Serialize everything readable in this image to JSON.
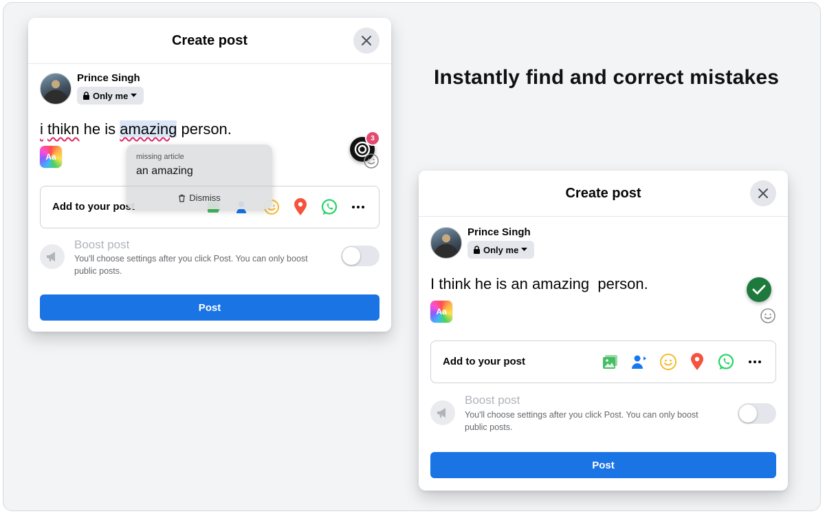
{
  "headline": "Instantly find and correct mistakes",
  "before": {
    "title": "Create post",
    "user_name": "Prince Singh",
    "privacy": "Only me",
    "text": {
      "w1": "i",
      "w2": "thikn",
      "w3": "he is",
      "w4": "amazing",
      "w5": "person."
    },
    "grammar_badge": "3",
    "suggestion": {
      "type": "missing article",
      "text": "an amazing",
      "dismiss": "Dismiss"
    },
    "aa": "Aa",
    "add_label": "Add to your post",
    "boost_title": "Boost post",
    "boost_desc": "You'll choose settings after you click Post. You can only boost public posts.",
    "post_label": "Post"
  },
  "after": {
    "title": "Create post",
    "user_name": "Prince Singh",
    "privacy": "Only me",
    "text": "I think he is an amazing  person.",
    "aa": "Aa",
    "add_label": "Add to your post",
    "boost_title": "Boost post",
    "boost_desc": "You'll choose settings after you click Post. You can only boost public posts.",
    "post_label": "Post"
  },
  "icons": [
    "close-icon",
    "lock-icon",
    "caret-down-icon",
    "grammar-assistant-icon",
    "smiley-icon",
    "photo-video-icon",
    "tag-people-icon",
    "feeling-icon",
    "location-pin-icon",
    "whatsapp-icon",
    "more-icon",
    "megaphone-icon",
    "trash-icon",
    "check-icon"
  ],
  "colors": {
    "primary": "#1b74e4",
    "error": "#e0245e",
    "success": "#1e7a3c",
    "badge": "#e24a6f"
  }
}
